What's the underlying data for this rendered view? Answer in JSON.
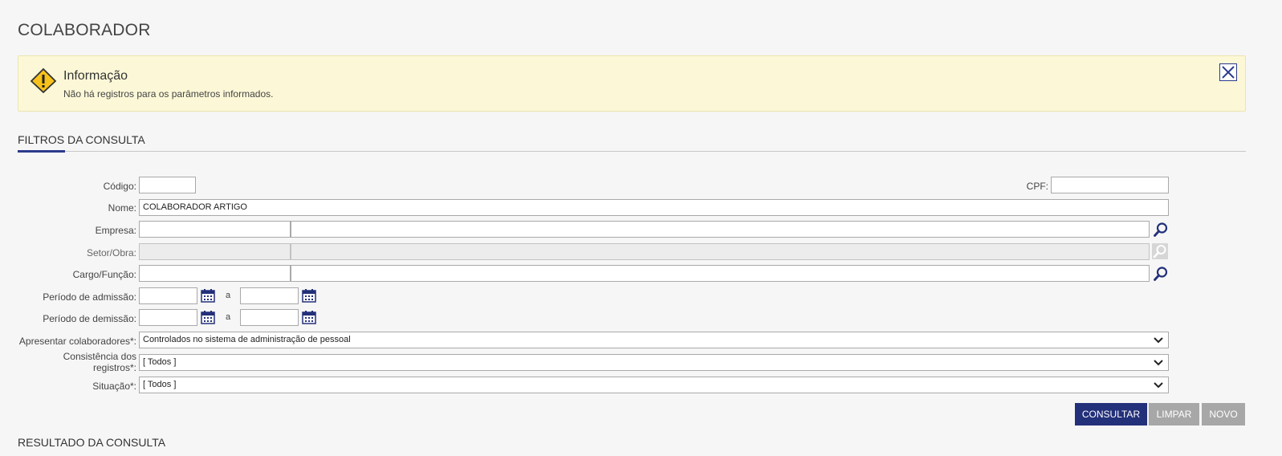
{
  "page": {
    "title": "COLABORADOR"
  },
  "alert": {
    "title": "Informação",
    "message": "Não há registros para os parâmetros informados.",
    "icon": "warning-icon",
    "close_icon": "close-icon"
  },
  "filters": {
    "section_title": "FILTROS DA CONSULTA",
    "codigo": {
      "label": "Código:",
      "value": ""
    },
    "cpf": {
      "label": "CPF:",
      "value": ""
    },
    "nome": {
      "label": "Nome:",
      "value": "COLABORADOR ARTIGO"
    },
    "empresa": {
      "label": "Empresa:",
      "code": "",
      "desc": ""
    },
    "setor": {
      "label": "Setor/Obra:",
      "code": "",
      "desc": ""
    },
    "cargo": {
      "label": "Cargo/Função:",
      "code": "",
      "desc": ""
    },
    "admissao": {
      "label": "Período de admissão:",
      "from": "",
      "sep": "a",
      "to": ""
    },
    "demissao": {
      "label": "Período de demissão:",
      "from": "",
      "sep": "a",
      "to": ""
    },
    "apresentar": {
      "label": "Apresentar colaboradores*:",
      "value": "Controlados no sistema de administração de pessoal"
    },
    "consistencia": {
      "label_line1": "Consistência dos",
      "label_line2": "registros*:",
      "value": "[ Todos ]"
    },
    "situacao": {
      "label": "Situação*:",
      "value": "[ Todos ]"
    }
  },
  "buttons": {
    "consultar": "CONSULTAR",
    "limpar": "LIMPAR",
    "novo": "NOVO"
  },
  "result": {
    "section_title": "RESULTADO DA CONSULTA"
  },
  "colors": {
    "accent": "#23307a",
    "alert_bg": "#fcf8d7",
    "disabled_button": "#a7a7a7"
  }
}
